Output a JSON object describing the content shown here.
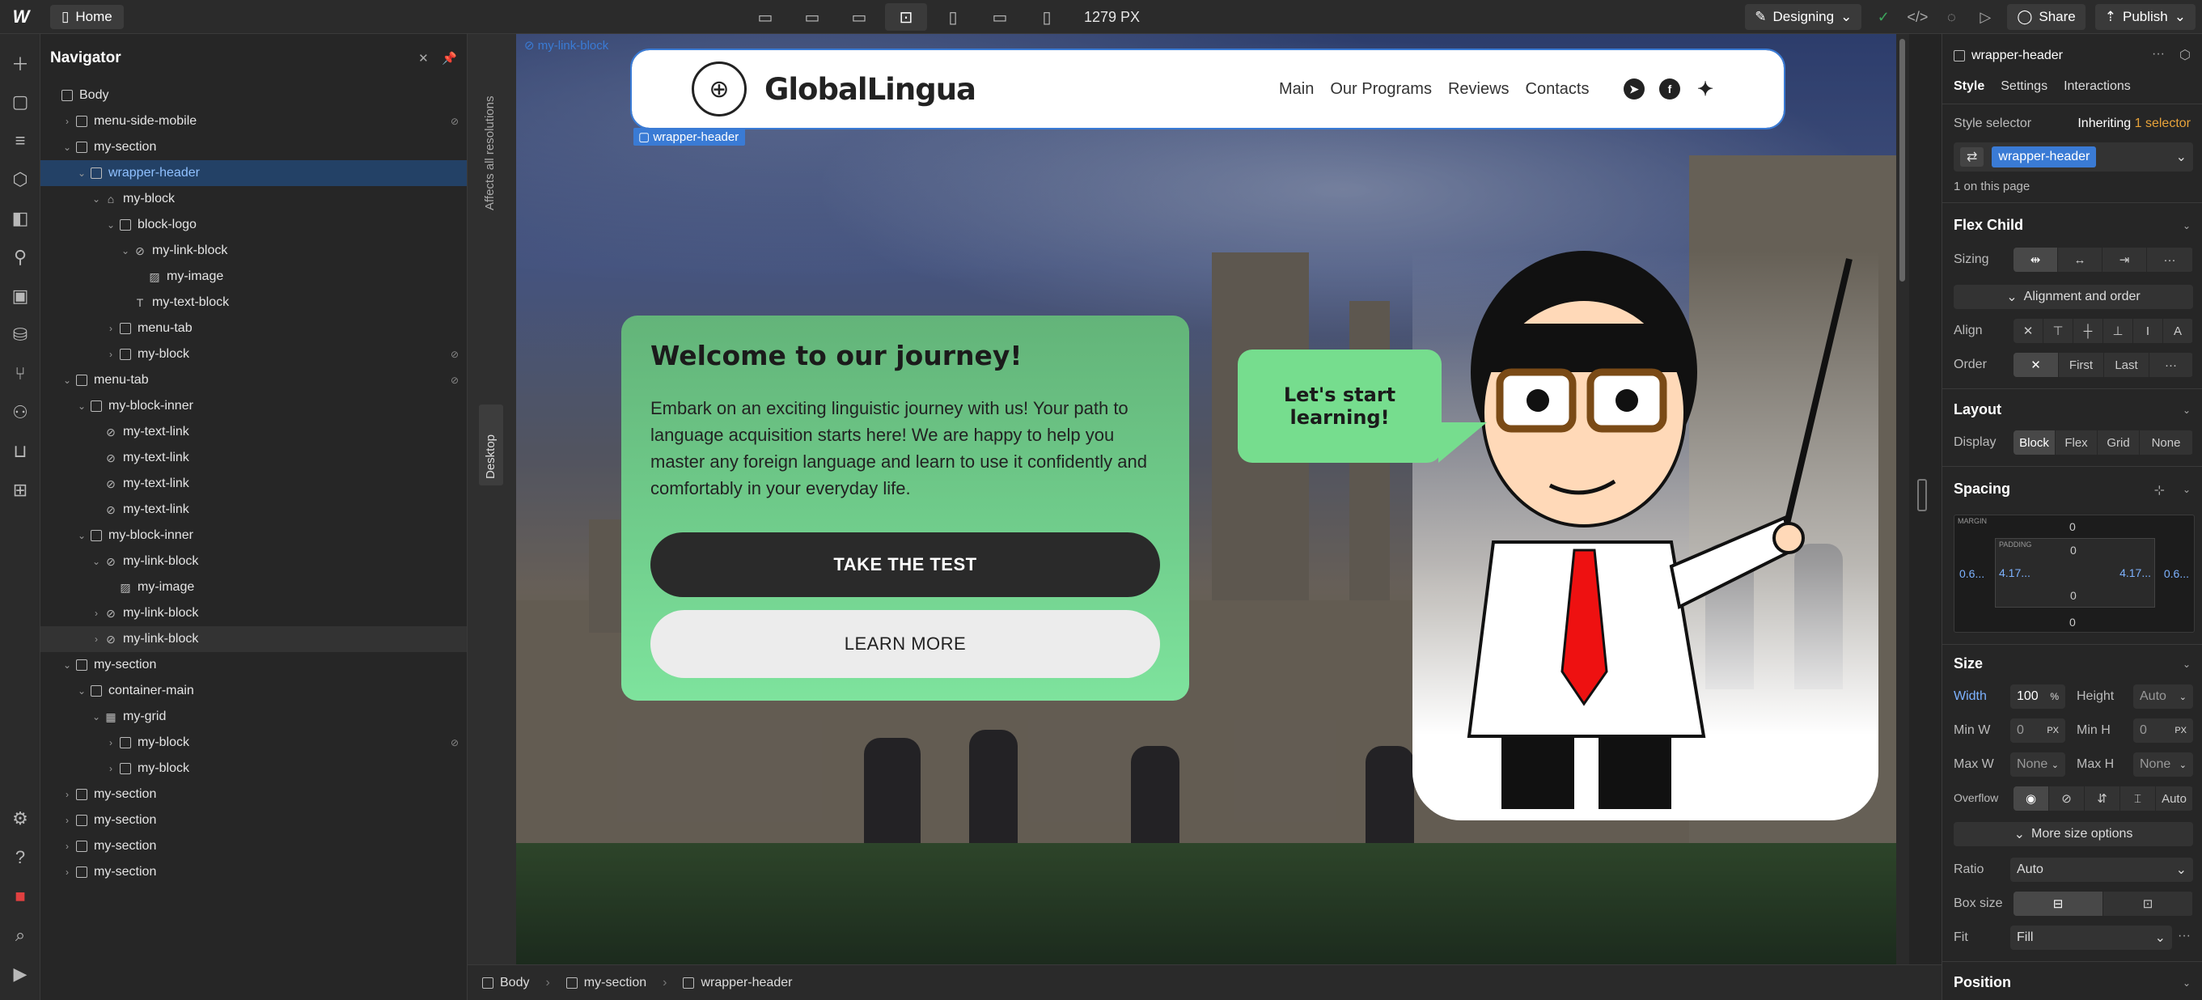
{
  "topbar": {
    "home_label": "Home",
    "width_label": "1279 PX",
    "mode_label": "Designing",
    "share_label": "Share",
    "publish_label": "Publish"
  },
  "navigator": {
    "title": "Navigator",
    "rows": [
      {
        "label": "Body",
        "depth": 0,
        "caret": "",
        "kind": "box"
      },
      {
        "label": "menu-side-mobile",
        "depth": 1,
        "caret": "›",
        "kind": "box",
        "flag": true
      },
      {
        "label": "my-section",
        "depth": 1,
        "caret": "⌄",
        "kind": "box"
      },
      {
        "label": "wrapper-header",
        "depth": 2,
        "caret": "⌄",
        "kind": "box",
        "selected": true
      },
      {
        "label": "my-block",
        "depth": 3,
        "caret": "⌄",
        "kind": "home"
      },
      {
        "label": "block-logo",
        "depth": 4,
        "caret": "⌄",
        "kind": "box"
      },
      {
        "label": "my-link-block",
        "depth": 5,
        "caret": "⌄",
        "kind": "link"
      },
      {
        "label": "my-image",
        "depth": 6,
        "caret": "",
        "kind": "img"
      },
      {
        "label": "my-text-block",
        "depth": 5,
        "caret": "",
        "kind": "text"
      },
      {
        "label": "menu-tab",
        "depth": 4,
        "caret": "›",
        "kind": "box"
      },
      {
        "label": "my-block",
        "depth": 4,
        "caret": "›",
        "kind": "box",
        "flag": true
      },
      {
        "label": "menu-tab",
        "depth": 1,
        "caret": "⌄",
        "kind": "box",
        "flag": true
      },
      {
        "label": "my-block-inner",
        "depth": 2,
        "caret": "⌄",
        "kind": "box"
      },
      {
        "label": "my-text-link",
        "depth": 3,
        "caret": "",
        "kind": "link"
      },
      {
        "label": "my-text-link",
        "depth": 3,
        "caret": "",
        "kind": "link"
      },
      {
        "label": "my-text-link",
        "depth": 3,
        "caret": "",
        "kind": "link"
      },
      {
        "label": "my-text-link",
        "depth": 3,
        "caret": "",
        "kind": "link"
      },
      {
        "label": "my-block-inner",
        "depth": 2,
        "caret": "⌄",
        "kind": "box"
      },
      {
        "label": "my-link-block",
        "depth": 3,
        "caret": "⌄",
        "kind": "link"
      },
      {
        "label": "my-image",
        "depth": 4,
        "caret": "",
        "kind": "img"
      },
      {
        "label": "my-link-block",
        "depth": 3,
        "caret": "›",
        "kind": "link"
      },
      {
        "label": "my-link-block",
        "depth": 3,
        "caret": "›",
        "kind": "link",
        "hover": true
      },
      {
        "label": "my-section",
        "depth": 1,
        "caret": "⌄",
        "kind": "box"
      },
      {
        "label": "container-main",
        "depth": 2,
        "caret": "⌄",
        "kind": "box"
      },
      {
        "label": "my-grid",
        "depth": 3,
        "caret": "⌄",
        "kind": "grid"
      },
      {
        "label": "my-block",
        "depth": 4,
        "caret": "›",
        "kind": "box",
        "flag": true
      },
      {
        "label": "my-block",
        "depth": 4,
        "caret": "›",
        "kind": "box"
      },
      {
        "label": "my-section",
        "depth": 1,
        "caret": "›",
        "kind": "box"
      },
      {
        "label": "my-section",
        "depth": 1,
        "caret": "›",
        "kind": "box"
      },
      {
        "label": "my-section",
        "depth": 1,
        "caret": "›",
        "kind": "box"
      },
      {
        "label": "my-section",
        "depth": 1,
        "caret": "›",
        "kind": "box"
      }
    ]
  },
  "canvas": {
    "vertical_note": "Affects all resolutions",
    "vertical_tab": "Desktop",
    "faint_tag": "my-link-block",
    "selected_tag": "wrapper-header"
  },
  "site": {
    "brand": "GlobalLingua",
    "menu": [
      "Main",
      "Our Programs",
      "Reviews",
      "Contacts"
    ],
    "hero_title": "Welcome to our journey!",
    "hero_text": "Embark on an exciting linguistic journey with us! Your path to language acquisition starts here! We are happy to help you master any foreign language and learn to use it confidently and comfortably in your everyday life.",
    "btn_primary": "TAKE THE TEST",
    "btn_secondary": "LEARN MORE",
    "bubble": "Let's start learning!"
  },
  "breadcrumb": [
    "Body",
    "my-section",
    "wrapper-header"
  ],
  "style_panel": {
    "element_name": "wrapper-header",
    "tabs": [
      "Style",
      "Settings",
      "Interactions"
    ],
    "style_selector_label": "Style selector",
    "inheriting_label": "Inheriting",
    "inheriting_count": "1 selector",
    "selector_chip": "wrapper-header",
    "on_page": "1 on this page",
    "flex_child_title": "Flex Child",
    "sizing_label": "Sizing",
    "alignment_btn": "Alignment and order",
    "align_label": "Align",
    "order_label": "Order",
    "order_first": "First",
    "order_last": "Last",
    "layout_title": "Layout",
    "display_label": "Display",
    "display_opts": [
      "Block",
      "Flex",
      "Grid",
      "None"
    ],
    "spacing_title": "Spacing",
    "margin_label": "MARGIN",
    "padding_label": "PADDING",
    "margin_left": "0.6...",
    "margin_right": "0.6...",
    "padding_left": "4.17...",
    "padding_right": "4.17...",
    "zero": "0",
    "size_title": "Size",
    "width_label": "Width",
    "width_val": "100",
    "width_unit": "%",
    "height_label": "Height",
    "height_val": "Auto",
    "minw_label": "Min W",
    "minw_val": "0",
    "minh_label": "Min H",
    "minh_val": "0",
    "px_unit": "PX",
    "maxw_label": "Max W",
    "maxw_val": "None",
    "maxh_label": "Max H",
    "maxh_val": "None",
    "overflow_label": "Overflow",
    "overflow_auto": "Auto",
    "more_size": "More size options",
    "ratio_label": "Ratio",
    "ratio_val": "Auto",
    "boxsize_label": "Box size",
    "fit_label": "Fit",
    "fit_val": "Fill",
    "position_title": "Position",
    "accent": "#3a7bd5"
  }
}
